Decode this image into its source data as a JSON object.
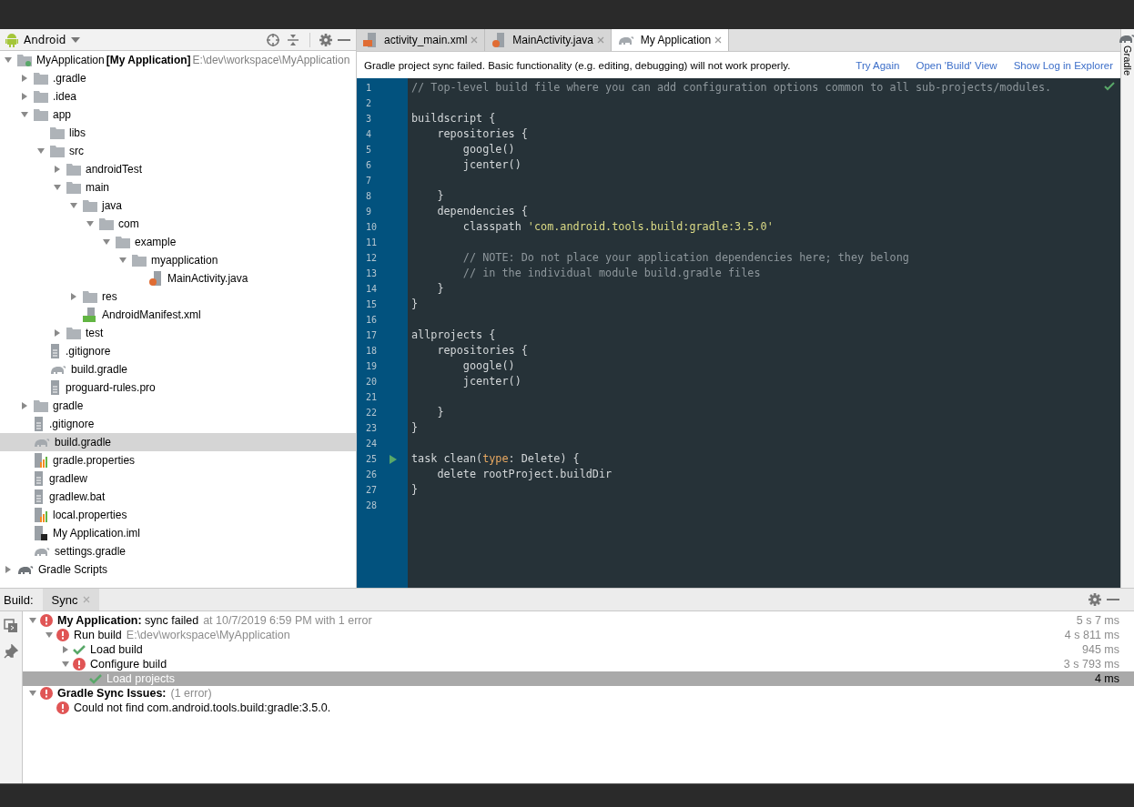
{
  "project_panel": {
    "view": "Android",
    "tree": [
      {
        "label": "MyApplication",
        "module": "[My Application]",
        "path": "E:\\dev\\workspace\\MyApplication",
        "kind": "project",
        "expanded": true,
        "selected": false,
        "children": [
          {
            "label": ".gradle",
            "kind": "folder",
            "expanded": false,
            "selected": false
          },
          {
            "label": ".idea",
            "kind": "folder",
            "expanded": false,
            "selected": false
          },
          {
            "label": "app",
            "kind": "folder",
            "expanded": true,
            "selected": false,
            "children": [
              {
                "label": "libs",
                "kind": "folder",
                "selected": false
              },
              {
                "label": "src",
                "kind": "folder",
                "expanded": true,
                "selected": false,
                "children": [
                  {
                    "label": "androidTest",
                    "kind": "folder",
                    "expanded": false,
                    "selected": false
                  },
                  {
                    "label": "main",
                    "kind": "folder",
                    "expanded": true,
                    "selected": false,
                    "children": [
                      {
                        "label": "java",
                        "kind": "folder",
                        "expanded": true,
                        "selected": false,
                        "children": [
                          {
                            "label": "com",
                            "kind": "folder",
                            "expanded": true,
                            "selected": false,
                            "children": [
                              {
                                "label": "example",
                                "kind": "folder",
                                "expanded": true,
                                "selected": false,
                                "children": [
                                  {
                                    "label": "myapplication",
                                    "kind": "folder",
                                    "expanded": true,
                                    "selected": false,
                                    "children": [
                                      {
                                        "label": "MainActivity.java",
                                        "kind": "java",
                                        "selected": false
                                      }
                                    ]
                                  }
                                ]
                              }
                            ]
                          }
                        ]
                      },
                      {
                        "label": "res",
                        "kind": "folder",
                        "expanded": false,
                        "selected": false
                      },
                      {
                        "label": "AndroidManifest.xml",
                        "kind": "manifest",
                        "selected": false
                      }
                    ]
                  },
                  {
                    "label": "test",
                    "kind": "folder",
                    "expanded": false,
                    "selected": false
                  }
                ]
              },
              {
                "label": ".gitignore",
                "kind": "text",
                "selected": false
              },
              {
                "label": "build.gradle",
                "kind": "gradle",
                "selected": false
              },
              {
                "label": "proguard-rules.pro",
                "kind": "text",
                "selected": false
              }
            ]
          },
          {
            "label": "gradle",
            "kind": "folder",
            "expanded": false,
            "selected": false
          },
          {
            "label": ".gitignore",
            "kind": "text",
            "selected": false
          },
          {
            "label": "build.gradle",
            "kind": "gradle",
            "selected": true
          },
          {
            "label": "gradle.properties",
            "kind": "properties",
            "selected": false
          },
          {
            "label": "gradlew",
            "kind": "text",
            "selected": false
          },
          {
            "label": "gradlew.bat",
            "kind": "text",
            "selected": false
          },
          {
            "label": "local.properties",
            "kind": "properties",
            "selected": false
          },
          {
            "label": "My Application.iml",
            "kind": "iml",
            "selected": false
          },
          {
            "label": "settings.gradle",
            "kind": "gradle",
            "selected": false
          }
        ]
      },
      {
        "label": "Gradle Scripts",
        "kind": "gradle-dark",
        "expanded": false,
        "selected": false
      }
    ]
  },
  "editor": {
    "tabs": [
      {
        "label": "activity_main.xml",
        "kind": "xml",
        "selected": false
      },
      {
        "label": "MainActivity.java",
        "kind": "java",
        "selected": false
      },
      {
        "label": "My Application",
        "kind": "gradle",
        "selected": true
      }
    ],
    "banner": {
      "message": "Gradle project sync failed. Basic functionality (e.g. editing, debugging) will not work properly.",
      "actions": [
        "Try Again",
        "Open 'Build' View",
        "Show Log in Explorer"
      ]
    },
    "lines": [
      {
        "number": "1",
        "segments": [
          {
            "kind": "comment",
            "text": "// Top-level build file where you can add configuration options common to all sub-projects/modules."
          }
        ]
      },
      {
        "number": "2"
      },
      {
        "number": "3",
        "segments": [
          {
            "kind": "plain",
            "text": "buildscript {"
          }
        ]
      },
      {
        "number": "4",
        "segments": [
          {
            "kind": "plain",
            "text": "    repositories {"
          }
        ]
      },
      {
        "number": "5",
        "segments": [
          {
            "kind": "plain",
            "text": "        google()"
          }
        ]
      },
      {
        "number": "6",
        "segments": [
          {
            "kind": "plain",
            "text": "        jcenter()"
          }
        ]
      },
      {
        "number": "7"
      },
      {
        "number": "8",
        "segments": [
          {
            "kind": "plain",
            "text": "    }"
          }
        ]
      },
      {
        "number": "9",
        "segments": [
          {
            "kind": "plain",
            "text": "    dependencies {"
          }
        ]
      },
      {
        "number": "10",
        "segments": [
          {
            "kind": "plain",
            "text": "        classpath "
          },
          {
            "kind": "string",
            "text": "'com.android.tools.build:gradle:3.5.0'"
          }
        ]
      },
      {
        "number": "11"
      },
      {
        "number": "12",
        "segments": [
          {
            "kind": "comment",
            "text": "        // NOTE: Do not place your application dependencies here; they belong"
          }
        ]
      },
      {
        "number": "13",
        "segments": [
          {
            "kind": "comment",
            "text": "        // in the individual module build.gradle files"
          }
        ]
      },
      {
        "number": "14",
        "segments": [
          {
            "kind": "plain",
            "text": "    }"
          }
        ]
      },
      {
        "number": "15",
        "segments": [
          {
            "kind": "plain",
            "text": "}"
          }
        ]
      },
      {
        "number": "16"
      },
      {
        "number": "17",
        "segments": [
          {
            "kind": "plain",
            "text": "allprojects {"
          }
        ]
      },
      {
        "number": "18",
        "segments": [
          {
            "kind": "plain",
            "text": "    repositories {"
          }
        ]
      },
      {
        "number": "19",
        "segments": [
          {
            "kind": "plain",
            "text": "        google()"
          }
        ]
      },
      {
        "number": "20",
        "segments": [
          {
            "kind": "plain",
            "text": "        jcenter()"
          }
        ]
      },
      {
        "number": "21"
      },
      {
        "number": "22",
        "segments": [
          {
            "kind": "plain",
            "text": "    }"
          }
        ]
      },
      {
        "number": "23",
        "segments": [
          {
            "kind": "plain",
            "text": "}"
          }
        ]
      },
      {
        "number": "24"
      },
      {
        "number": "25",
        "run_marker": true,
        "segments": [
          {
            "kind": "plain",
            "text": "task clean("
          },
          {
            "kind": "keyword",
            "text": "type"
          },
          {
            "kind": "plain",
            "text": ": Delete) {"
          }
        ]
      },
      {
        "number": "26",
        "segments": [
          {
            "kind": "plain",
            "text": "    delete rootProject.buildDir"
          }
        ]
      },
      {
        "number": "27",
        "segments": [
          {
            "kind": "plain",
            "text": "}"
          }
        ]
      },
      {
        "number": "28"
      }
    ]
  },
  "side_strip": {
    "label": "Gradle"
  },
  "build_panel": {
    "label": "Build:",
    "tabs": [
      {
        "label": "Sync",
        "selected": true
      }
    ],
    "tree": [
      {
        "kind": "error",
        "title": "**My Application:** sync failed",
        "detail": "at 10/7/2019 6:59 PM  with 1 error",
        "time": "5 s 7 ms",
        "expanded": true,
        "selected": false,
        "children": [
          {
            "kind": "error",
            "title": "Run build",
            "detail": "E:\\dev\\workspace\\MyApplication",
            "time": "4 s 811 ms",
            "expanded": true,
            "selected": false,
            "children": [
              {
                "kind": "ok",
                "title": "Load build",
                "time": "945 ms",
                "expanded": false,
                "selected": false
              },
              {
                "kind": "error",
                "title": "Configure build",
                "time": "3 s 793 ms",
                "expanded": true,
                "selected": false,
                "children": [
                  {
                    "kind": "ok",
                    "title": "Load projects",
                    "time": "4 ms",
                    "selected": true
                  }
                ]
              }
            ]
          }
        ]
      },
      {
        "kind": "error",
        "title": "**Gradle Sync Issues:**",
        "detail": "(1 error)",
        "expanded": true,
        "selected": false,
        "children": [
          {
            "kind": "error",
            "title": "Could not find com.android.tools.build:gradle:3.5.0.",
            "selected": false
          }
        ]
      }
    ]
  }
}
